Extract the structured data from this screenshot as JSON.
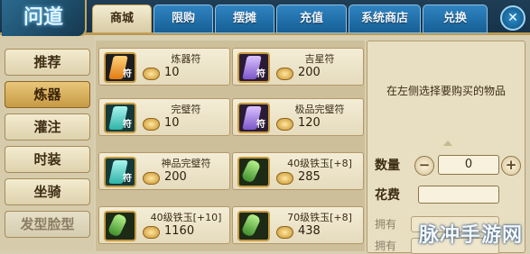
{
  "app": {
    "logo_text": "问道"
  },
  "tabs": [
    {
      "label": "商城",
      "active": true
    },
    {
      "label": "限购",
      "active": false
    },
    {
      "label": "摆摊",
      "active": false
    },
    {
      "label": "充值",
      "active": false
    },
    {
      "label": "系统商店",
      "active": false
    },
    {
      "label": "兑换",
      "active": false
    }
  ],
  "close_icon": "close-icon",
  "sidebar": {
    "items": [
      {
        "label": "推荐"
      },
      {
        "label": "炼器",
        "active": true
      },
      {
        "label": "灌注"
      },
      {
        "label": "时装"
      },
      {
        "label": "坐骑"
      },
      {
        "label": "发型脸型"
      }
    ]
  },
  "items": [
    {
      "name": "炼器符",
      "price": "10",
      "icon": "orange-talisman-icon"
    },
    {
      "name": "吉星符",
      "price": "200",
      "icon": "purple-talisman-icon"
    },
    {
      "name": "完璧符",
      "price": "10",
      "icon": "green-talisman-icon"
    },
    {
      "name": "极品完璧符",
      "price": "120",
      "icon": "purple-talisman-icon"
    },
    {
      "name": "神品完璧符",
      "price": "200",
      "icon": "green-talisman-icon"
    },
    {
      "name": "40级铁玉[+8]",
      "price": "285",
      "icon": "jade-icon"
    },
    {
      "name": "40级铁玉[+10]",
      "price": "1160",
      "icon": "jade-icon"
    },
    {
      "name": "70级铁玉[+8]",
      "price": "438",
      "icon": "jade-icon"
    }
  ],
  "detail": {
    "hint": "在左侧选择要购买的物品",
    "quantity_label": "数量",
    "quantity_value": "0",
    "minus": "−",
    "plus": "+",
    "cost_label": "花费",
    "own_label_1": "拥有",
    "own_label_2": "拥有"
  },
  "watermark": "脉冲手游网",
  "colors": {
    "tab_blue": "#2f84c1",
    "gold_border": "#c5a65f",
    "parchment": "#e8dfc3"
  }
}
